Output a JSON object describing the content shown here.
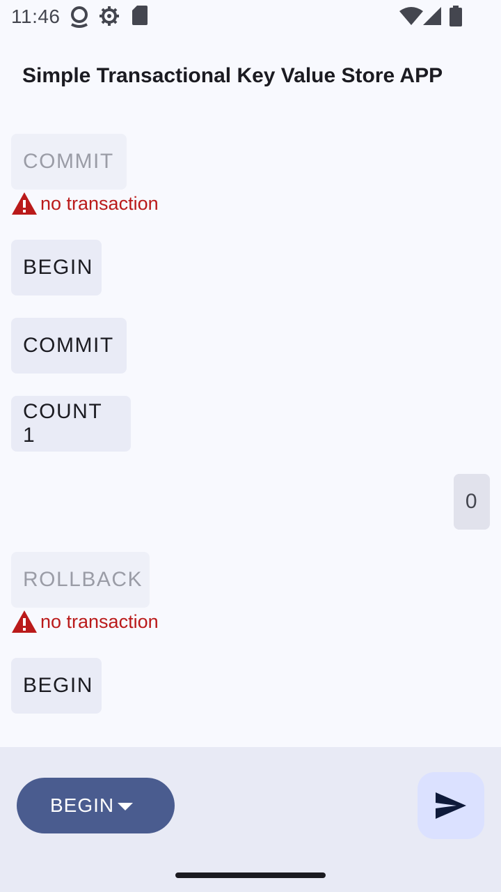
{
  "status_bar": {
    "time": "11:46",
    "icons": [
      "assistant-icon",
      "settings-gear-icon",
      "sd-card-icon",
      "wifi-icon",
      "cell-signal-icon",
      "battery-icon"
    ]
  },
  "app": {
    "title": "Simple Transactional Key Value Store APP"
  },
  "messages": [
    {
      "label": "COMMIT",
      "state": "disabled",
      "error": "no transaction"
    },
    {
      "label": "BEGIN",
      "state": "sent"
    },
    {
      "label": "COMMIT",
      "state": "sent"
    },
    {
      "label": "COUNT 1",
      "state": "sent"
    },
    {
      "label": "0",
      "state": "reply"
    },
    {
      "label": "ROLLBACK",
      "state": "disabled",
      "error": "no transaction"
    },
    {
      "label": "BEGIN",
      "state": "sent"
    }
  ],
  "composer": {
    "selected_command": "BEGIN",
    "send_icon": "send-icon"
  },
  "colors": {
    "error": "#ba1a1a",
    "primary": "#4a5c8f",
    "send_bg": "#dbe1ff"
  }
}
